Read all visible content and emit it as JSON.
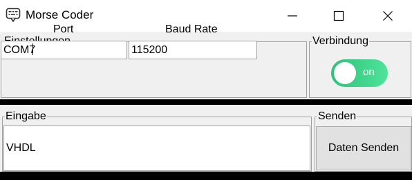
{
  "window": {
    "title": "Morse Coder",
    "icon": "morse-keyboard-icon",
    "controls": [
      "minimize-icon",
      "maximize-icon",
      "close-icon"
    ]
  },
  "settings": {
    "legend": "Einstellungen",
    "port_label": "Port",
    "baud_label": "Baud Rate",
    "port_value": "COM7",
    "baud_value": "115200"
  },
  "connection": {
    "legend": "Verbindung",
    "toggle_label": "on",
    "toggle_state": "on",
    "accent": "#2fc27a"
  },
  "input": {
    "legend": "Eingabe",
    "text": "VHDL"
  },
  "send": {
    "legend": "Senden",
    "button_label": "Daten Senden"
  }
}
